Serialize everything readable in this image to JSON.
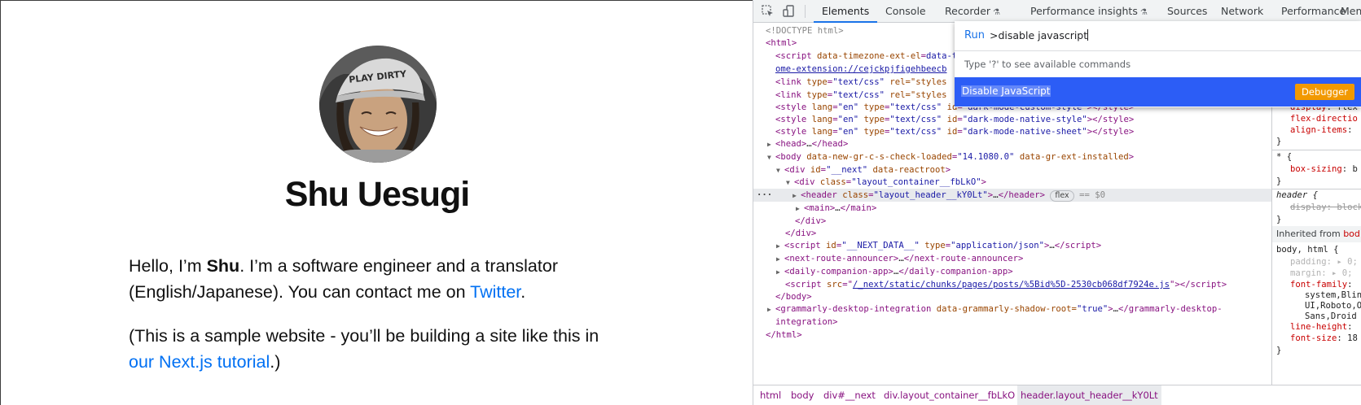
{
  "site": {
    "name": "Shu Uesugi",
    "p1_before": "Hello, I’m ",
    "p1_bold": "Shu",
    "p1_after": ". I’m a software engineer and a translator (English/Japanese). You can contact me on ",
    "p1_link": "Twitter",
    "p1_end": ".",
    "p2_before": "(This is a sample website - you’ll be building a site like this in ",
    "p2_link": "our Next.js tutorial",
    "p2_end": ".)",
    "cap_text": "PLAY DIRTY"
  },
  "devtools": {
    "tabs": [
      "Elements",
      "Console",
      "Recorder",
      "Performance insights",
      "Sources",
      "Network",
      "Performance",
      "Memo"
    ],
    "command_menu": {
      "prefix": "Run",
      "query": ">disable javascript",
      "hint": "Type '?' to see available commands",
      "item_label": "Disable JavaScript",
      "item_badge": "Debugger"
    },
    "dom": {
      "doctype": "<!DOCTYPE html>",
      "html_open": "<html>",
      "script_tz_attr": "data-timezone-ext-el=\"[\"AF",
      "script_tz_link": "ome-extension://cejckpjfigehbeecb",
      "link_attr": "rel=\"styles",
      "style1_id": "\"dark-mode-custom-style\"",
      "style2_id": "\"dark-mode-native-style\"",
      "style3_id": "\"dark-mode-native-sheet\"",
      "body_loaded": "\"14.1080.0\"",
      "next_id": "\"__next\"",
      "container_class": "\"layout_container__fbLkO\"",
      "header_class": "\"layout_header__kY0Lt\"",
      "flex_badge": "flex",
      "dollar0": "== $0",
      "next_data_id": "\"__NEXT_DATA__\"",
      "json_type": "\"application/json\"",
      "script_src": "/_next/static/chunks/pages/posts/%5Bid%5D-2530cb068df7924e.js",
      "grammarly": "data-grammarly-shadow-root=",
      "grammarly_val": "\"true\"",
      "grammarly_close_end": "integration>",
      "html_close": "</html>"
    },
    "styles": {
      "l1p": "display",
      "l1v": "flex",
      "l2p": "flex-directio",
      "l3p": "align-items",
      "star_rule": "* {",
      "box_sizing": "box-sizing",
      "box_val": "b",
      "header_rule": "header {",
      "header_display": "display: block",
      "inherited_label": "Inherited from ",
      "inherited_from": "bod",
      "body_rule": "body, html {",
      "padding": "padding",
      "padding_v": "0;",
      "margin": "margin",
      "margin_v": "0;",
      "font_family": "font-family",
      "ff1": "system,Blin",
      "ff2": "UI,Roboto,O",
      "ff3": "Sans,Droid",
      "line_height": "line-height",
      "font_size": "font-size",
      "font_size_v": "18"
    },
    "breadcrumbs": [
      "html",
      "body",
      "div#__next",
      "div.layout_container__fbLkO",
      "header.layout_header__kY0Lt"
    ]
  }
}
